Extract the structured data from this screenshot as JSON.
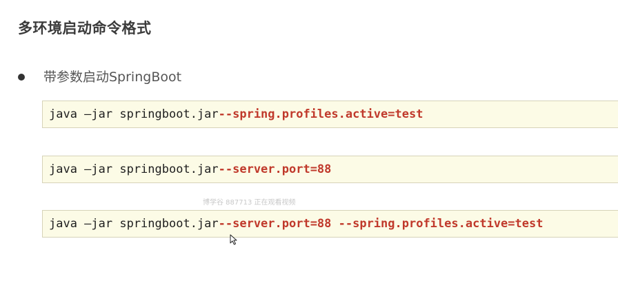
{
  "slide": {
    "title": "多环境启动命令格式",
    "bullet": "带参数启动SpringBoot"
  },
  "commands": [
    {
      "plain": "java –jar springboot.jar ",
      "args": "--spring.profiles.active=test"
    },
    {
      "plain": "java –jar springboot.jar ",
      "args": "--server.port=88"
    },
    {
      "plain": "java –jar springboot.jar ",
      "args": "--server.port=88 --spring.profiles.active=test"
    }
  ],
  "watermark": "博学谷 887713 正在观看视频",
  "colors": {
    "arg": "#c0392b",
    "code_bg": "#fcfbe6",
    "title": "#3b3b3b"
  },
  "icons": {
    "cursor": "mouse-pointer-icon"
  }
}
